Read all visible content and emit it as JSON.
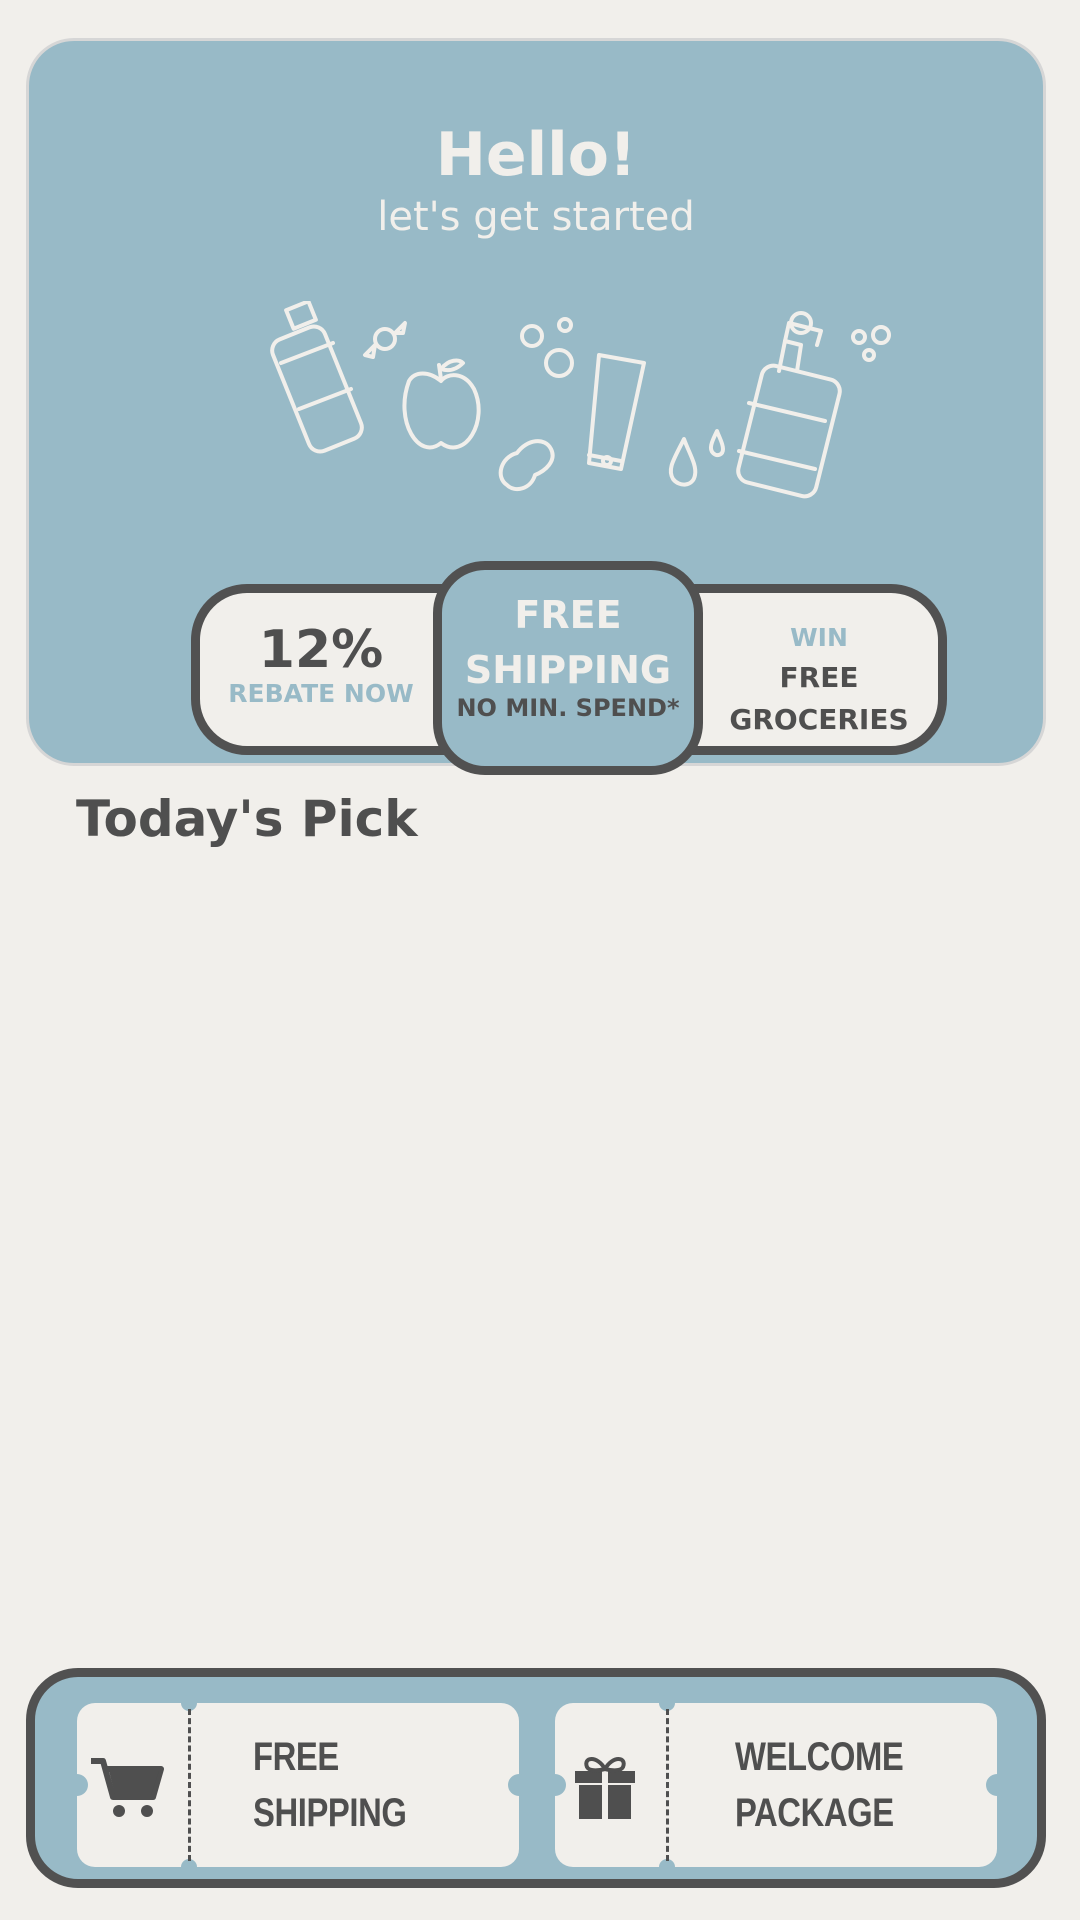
{
  "hero": {
    "greeting": "Hello!",
    "subgreeting": "let's get started"
  },
  "offers": {
    "rebate_value": "12%",
    "rebate_label": "REBATE NOW",
    "shipping_line1": "FREE",
    "shipping_line2": "SHIPPING",
    "shipping_note": "NO MIN. SPEND*",
    "win_label": "WIN",
    "groceries_line1": "FREE",
    "groceries_line2": "GROCERIES"
  },
  "section": {
    "title": "Today's Pick"
  },
  "coupons": [
    {
      "icon": "cart-icon",
      "line1": "FREE",
      "line2": "SHIPPING"
    },
    {
      "icon": "gift-icon",
      "line1": "WELCOME",
      "line2": "PACKAGE"
    }
  ],
  "colors": {
    "background": "#f1efeb",
    "accent": "#98bac7",
    "dark": "#4f4f4f"
  }
}
